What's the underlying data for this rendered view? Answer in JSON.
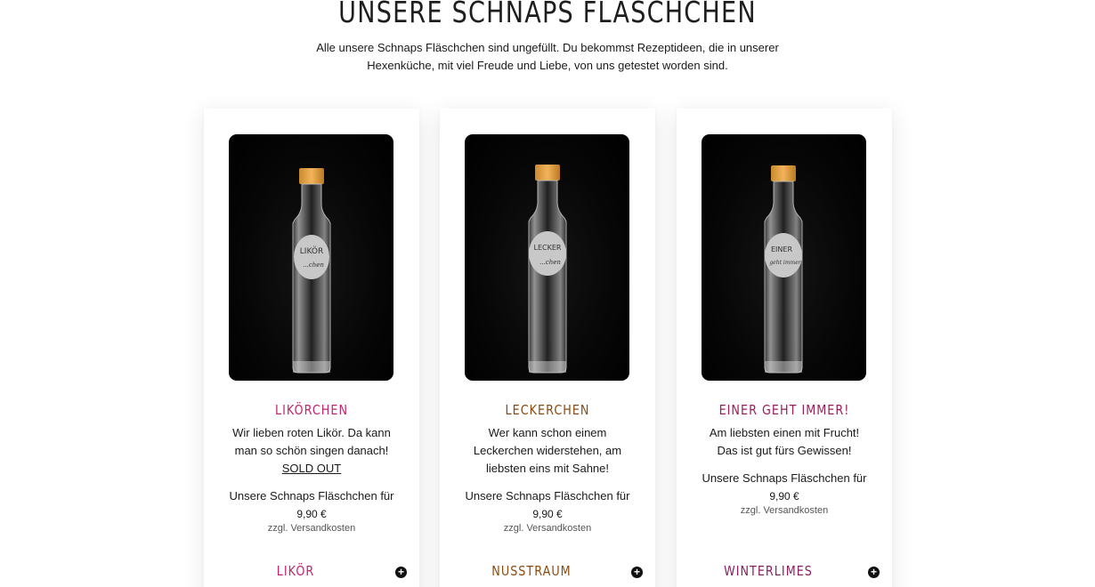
{
  "header": {
    "title": "UNSERE SCHNAPS FLASCHCHEN",
    "intro_line1": "Alle unsere Schnaps Fläschchen sind ungefüllt. Du bekommst Rezeptideen, die in unserer",
    "intro_line2": "Hexenküche, mit viel Freude und Liebe, von uns getestet worden sind."
  },
  "colors": {
    "likoerchen": "#c0266d",
    "leckerchen": "#8a4a10",
    "einer": "#9b1d5a",
    "nusstraum": "#8a4a10",
    "winterlimes": "#8a2060"
  },
  "products": [
    {
      "name": "LIKÖRCHEN",
      "label_main": "LIKÖR",
      "label_sub": "...chen",
      "desc_line1": "Wir lieben roten Likör. Da kann",
      "desc_line2": "man so schön singen danach!",
      "badge": "SOLD OUT",
      "price_text": "Unsere Schnaps Fläschchen für",
      "price": "9,90 €",
      "shipping": "zzgl. Versandkosten",
      "accordion": "LIKÖR"
    },
    {
      "name": "LECKERCHEN",
      "label_main": "LECKER",
      "label_sub": "...chen",
      "desc_line1": "Wer kann schon einem",
      "desc_line2": "Leckerchen widerstehen, am",
      "desc_line3": "liebsten eins mit Sahne!",
      "price_text": "Unsere Schnaps Fläschchen für",
      "price": "9,90 €",
      "shipping": "zzgl. Versandkosten",
      "accordion": "NUSSTRAUM"
    },
    {
      "name": "EINER GEHT IMMER!",
      "label_main": "EINER",
      "label_sub": "geht immer",
      "desc_line1": "Am liebsten einen mit Frucht!",
      "desc_line2": "Das ist gut fürs Gewissen!",
      "price_text": "Unsere Schnaps Fläschchen für",
      "price": "9,90 €",
      "shipping": "zzgl. Versandkosten",
      "accordion": "WINTERLIMES"
    }
  ]
}
